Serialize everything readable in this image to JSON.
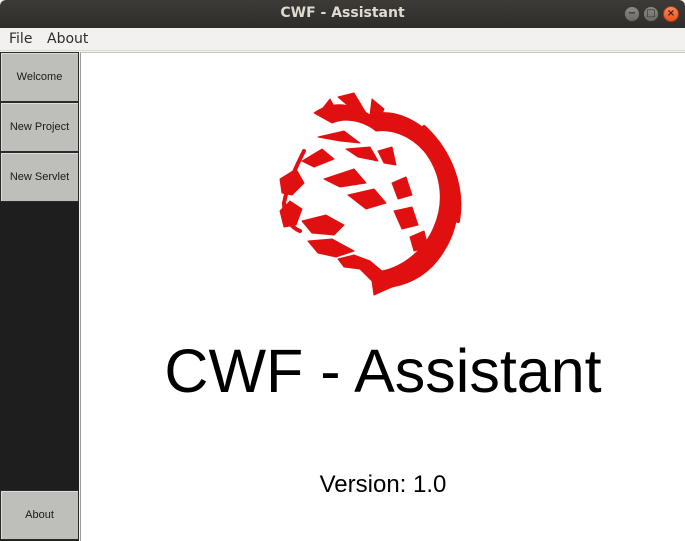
{
  "window": {
    "title": "CWF - Assistant",
    "controls": {
      "minimize": "−",
      "maximize": "□",
      "close": "×"
    }
  },
  "menu": {
    "file": "File",
    "about": "About"
  },
  "sidebar": {
    "items": [
      {
        "label": "Welcome"
      },
      {
        "label": "New Project"
      },
      {
        "label": "New Servlet"
      }
    ],
    "bottom": {
      "label": "About"
    }
  },
  "main": {
    "logo_icon": "panther-head-logo",
    "logo_color": "#e01010",
    "app_title": "CWF - Assistant",
    "version": "Version: 1.0"
  }
}
